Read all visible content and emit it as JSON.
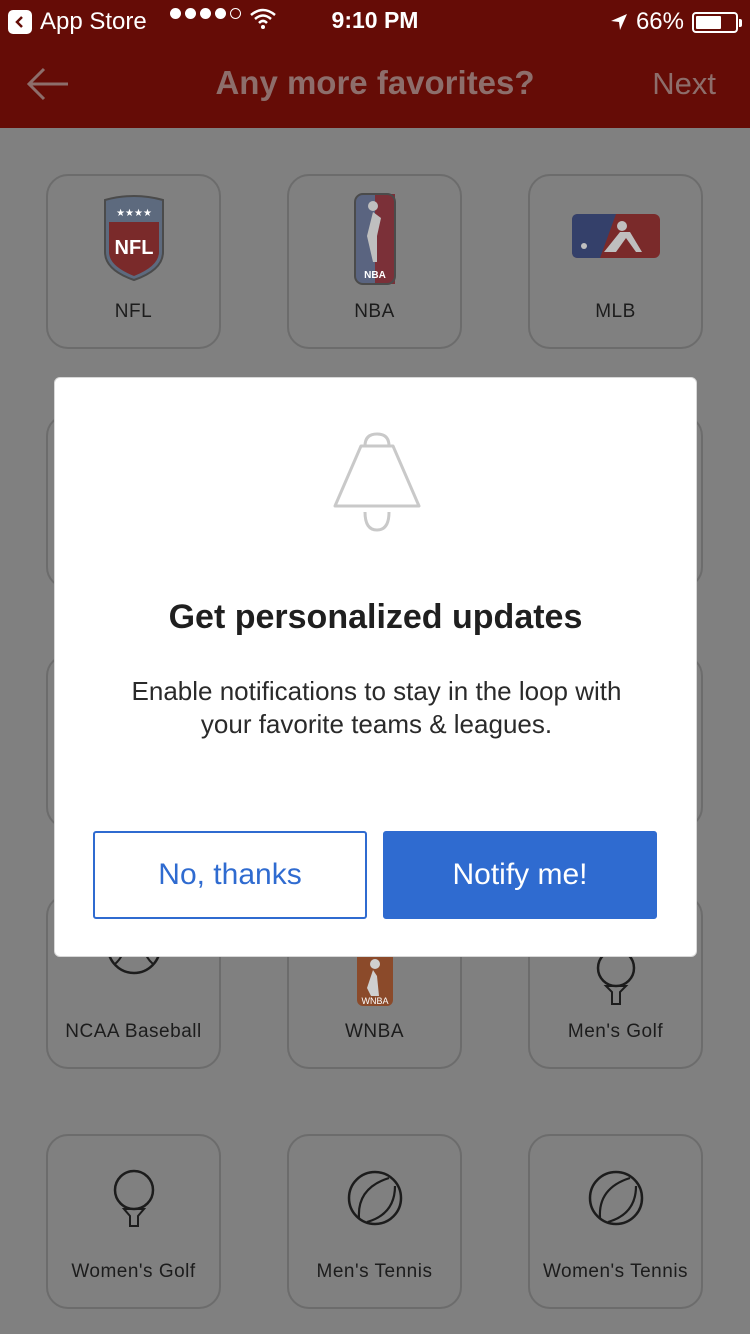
{
  "status_bar": {
    "back_app": "App Store",
    "time": "9:10 PM",
    "battery": "66%",
    "battery_level": 0.66
  },
  "nav": {
    "title": "Any more favorites?",
    "next": "Next"
  },
  "tiles": [
    {
      "label": "NFL",
      "icon": "nfl-logo"
    },
    {
      "label": "NBA",
      "icon": "nba-logo"
    },
    {
      "label": "MLB",
      "icon": "mlb-logo"
    },
    {
      "label": "NCAA Baseball",
      "icon": "baseball-icon"
    },
    {
      "label": "WNBA",
      "icon": "wnba-logo"
    },
    {
      "label": "Men's Golf",
      "icon": "golf-ball-tee-icon"
    },
    {
      "label": "Women's Golf",
      "icon": "golf-ball-tee-icon"
    },
    {
      "label": "Men's Tennis",
      "icon": "tennis-ball-icon"
    },
    {
      "label": "Women's Tennis",
      "icon": "tennis-ball-icon"
    }
  ],
  "modal": {
    "icon": "bell-icon",
    "title": "Get personalized updates",
    "body_line1": "Enable notifications to stay in the loop with",
    "body_line2": "your favorite teams & leagues.",
    "no_button": "No, thanks",
    "yes_button": "Notify me!"
  },
  "colors": {
    "header": "#650c06",
    "overlay_bg": "#808080",
    "primary": "#2f6bd0"
  }
}
